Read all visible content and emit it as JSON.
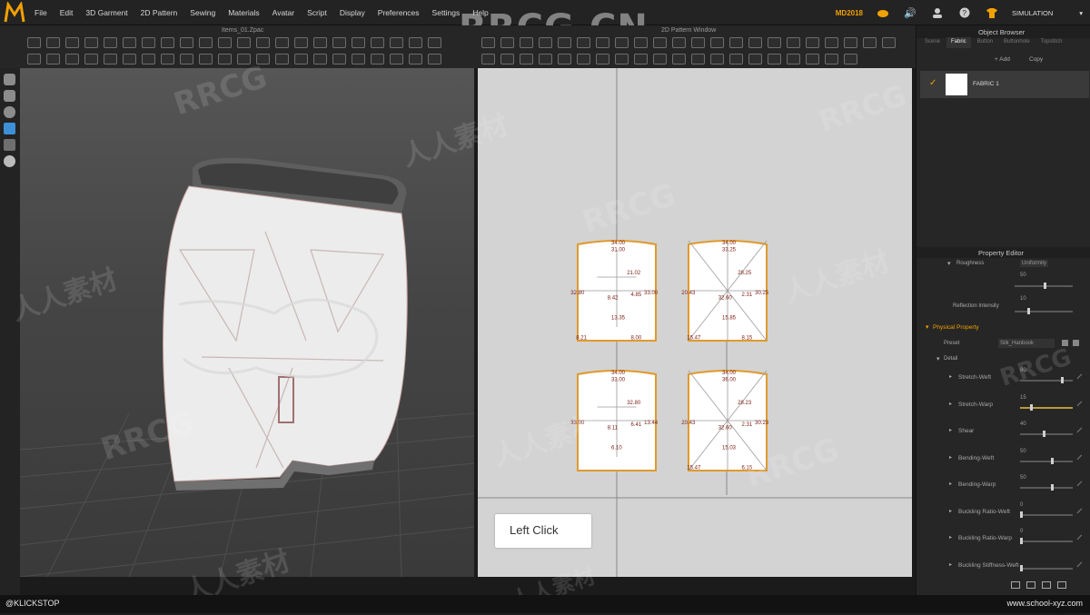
{
  "app": {
    "logo": "M"
  },
  "menu": [
    "File",
    "Edit",
    "3D Garment",
    "2D Pattern",
    "Sewing",
    "Materials",
    "Avatar",
    "Script",
    "Display",
    "Preferences",
    "Settings",
    "Help"
  ],
  "toolbar_right": {
    "badge": "MD2018",
    "mode": "SIMULATION"
  },
  "watermark": "RRCG.CN",
  "view3d": {
    "title": "Items_01.Zpac"
  },
  "view2d": {
    "title": "2D Pattern Window"
  },
  "object_browser": {
    "title": "Object Browser",
    "tabs": [
      "Scene",
      "Fabric",
      "Button",
      "Buttonhole",
      "Topstitch"
    ],
    "active_tab": "Fabric",
    "add": "+ Add",
    "copy": "Copy",
    "fabric_name": "FABRIC 1"
  },
  "property_editor": {
    "title": "Property Editor",
    "top_row": {
      "label": "Roughness",
      "value": "Uniformity"
    },
    "reflection": {
      "label": "Reflection Intensity",
      "value": "10"
    },
    "reflection_top": "50",
    "section": "Physical Property",
    "preset": {
      "label": "Preset",
      "value": "Silk_Hanbook"
    },
    "detail": "Detail",
    "rows": [
      {
        "label": "Stretch-Weft",
        "value": "80",
        "level": 0.8
      },
      {
        "label": "Stretch-Warp",
        "value": "15",
        "level": 0.2
      },
      {
        "label": "Shear",
        "value": "40",
        "level": 0.45
      },
      {
        "label": "Bending-Weft",
        "value": "50",
        "level": 0.6
      },
      {
        "label": "Bending-Warp",
        "value": "50",
        "level": 0.6
      },
      {
        "label": "Buckling Ratio-Weft",
        "value": "0",
        "level": 0.0
      },
      {
        "label": "Buckling Ratio-Warp",
        "value": "0",
        "level": 0.0
      },
      {
        "label": "Buckling Stiffness-Weft",
        "value": "",
        "level": 0.0
      }
    ]
  },
  "pattern_labels": {
    "p1": [
      "34.00",
      "31.00",
      "21.02",
      "32.80",
      "8.42",
      "4.85",
      "33.00",
      "13.35",
      "8.21",
      "8.00"
    ],
    "p2": [
      "34.00",
      "33.25",
      "28.25",
      "20.43",
      "32.60",
      "2.31",
      "30.25",
      "15.85",
      "15.47",
      "8.15"
    ],
    "p3": [
      "34.00",
      "33.00",
      "32.80",
      "33.00",
      "8.11",
      "6.41",
      "13.44",
      "6.10"
    ],
    "p4": [
      "34.00",
      "36.00",
      "28.23",
      "20.43",
      "32.60",
      "2.31",
      "30.23",
      "15.03",
      "15.47",
      "6.15"
    ]
  },
  "callout": "Left Click",
  "status": {
    "left": "@KLICKSTOP",
    "right": "www.school-xyz.com"
  },
  "watermarks_cn": "人人素材",
  "watermark_rrcg": "RRCG"
}
